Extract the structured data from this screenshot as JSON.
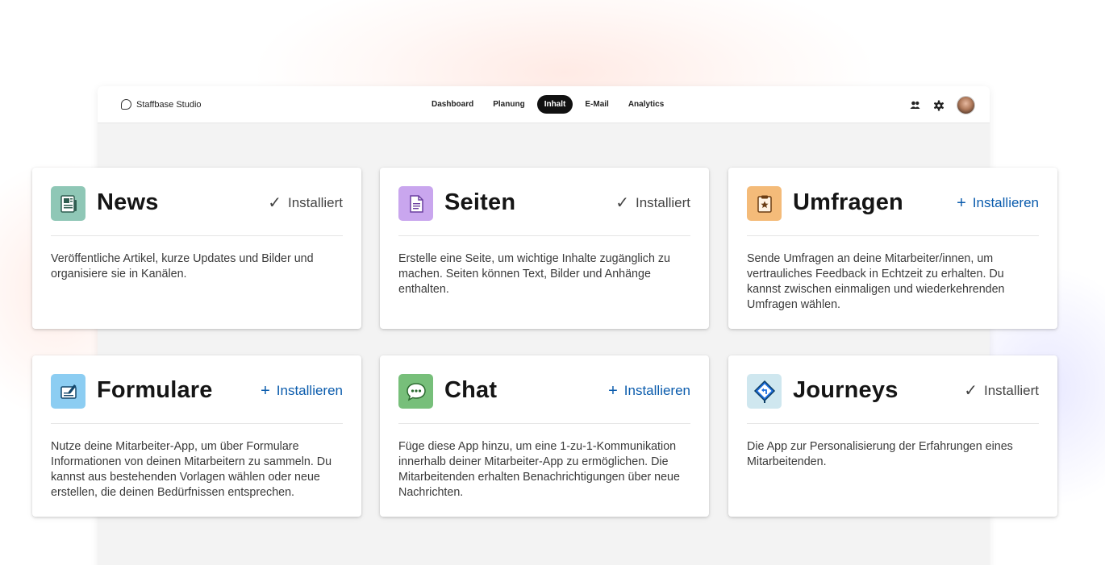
{
  "window": {
    "brand": "Staffbase Studio",
    "brand_icon": "chat-bubble-icon",
    "nav": [
      "Dashboard",
      "Planung",
      "Inhalt",
      "E-Mail",
      "Analytics"
    ],
    "active_nav": "Inhalt",
    "tools": [
      "users-icon",
      "gear-icon",
      "avatar"
    ]
  },
  "status_labels": {
    "installed": "Installiert",
    "install": "Installieren"
  },
  "colors": {
    "install_link": "#0b5cad",
    "active_tab": "#111111"
  },
  "apps": [
    {
      "title": "News",
      "icon": "newspaper-icon",
      "icon_bg": "#8fc7b6",
      "status": "installed",
      "status_text": "Installiert",
      "description": "Veröffentliche Artikel, kurze Updates und Bilder und organisiere sie in Kanälen."
    },
    {
      "title": "Seiten",
      "icon": "page-icon",
      "icon_bg": "#c9a6ee",
      "status": "installed",
      "status_text": "Installiert",
      "description": "Erstelle eine Seite, um wichtige Inhalte zugänglich zu machen. Seiten können Text, Bilder und Anhänge enthalten."
    },
    {
      "title": "Umfragen",
      "icon": "clipboard-star-icon",
      "icon_bg": "#f4bb79",
      "status": "install",
      "status_text": "Installieren",
      "description": "Sende Umfragen an deine Mitarbeiter/innen, um vertrauliches Feedback in Echtzeit zu erhalten. Du kannst zwischen einmaligen und wiederkehrenden Umfragen wählen."
    },
    {
      "title": "Formulare",
      "icon": "form-pen-icon",
      "icon_bg": "#8ccdf2",
      "status": "install",
      "status_text": "Installieren",
      "description": "Nutze deine Mitarbeiter-App, um über Formulare Informationen von deinen Mitarbeitern zu sammeln. Du kannst aus bestehenden Vorlagen wählen oder neue erstellen, die deinen Bedürfnissen entsprechen."
    },
    {
      "title": "Chat",
      "icon": "chat-dots-icon",
      "icon_bg": "#77bf7a",
      "status": "install",
      "status_text": "Installieren",
      "description": "Füge diese App hinzu, um eine 1-zu-1-Kommunikation innerhalb deiner Mitarbeiter-App zu ermöglichen. Die Mitarbeitenden erhalten Benachrichtigungen über neue Nachrichten."
    },
    {
      "title": "Journeys",
      "icon": "route-sign-icon",
      "icon_bg": "#cfe7ef",
      "status": "installed",
      "status_text": "Installiert",
      "description": "Die App zur Personalisierung der Erfahrungen eines Mitarbeitenden."
    }
  ]
}
